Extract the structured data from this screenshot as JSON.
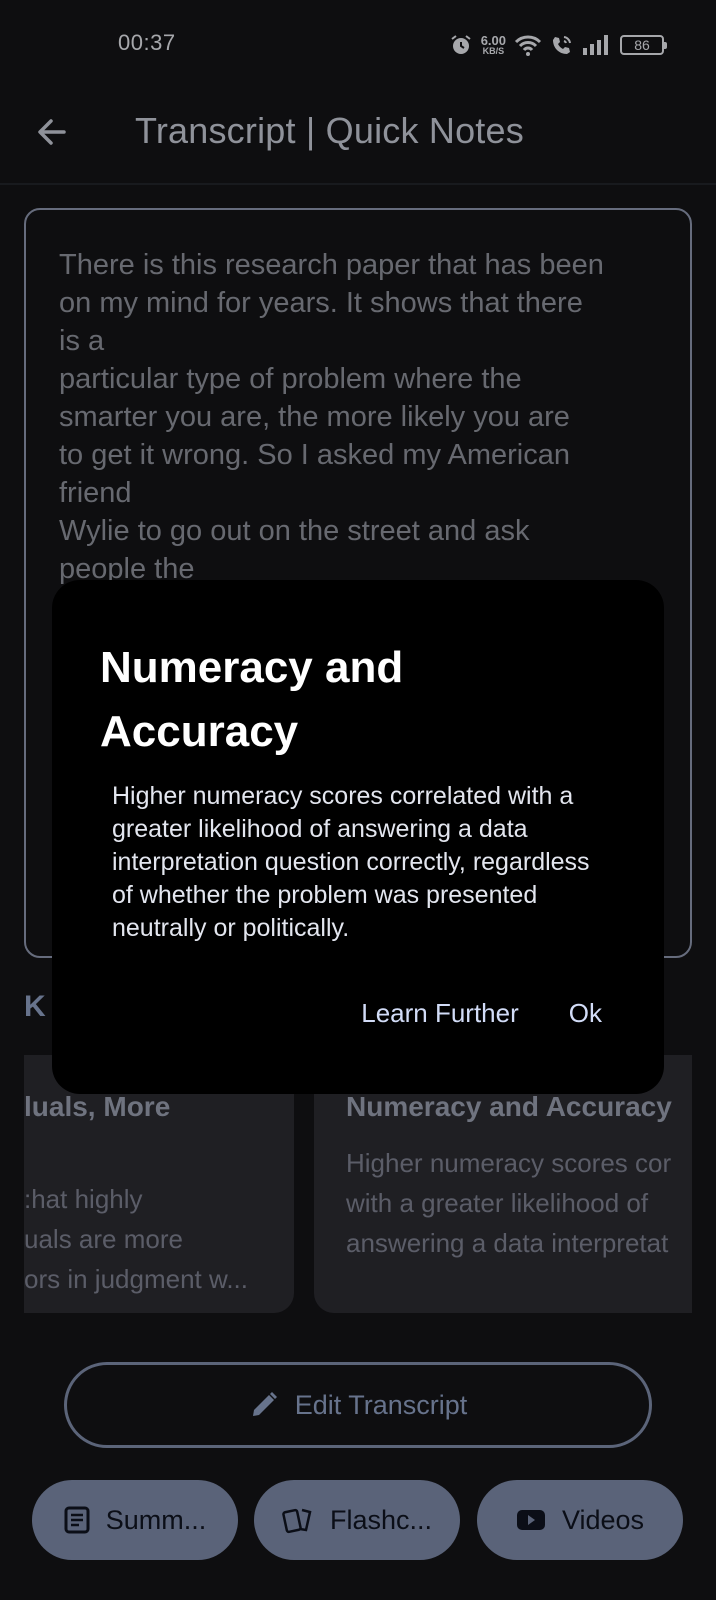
{
  "status_bar": {
    "time": "00:37",
    "net_speed": "6.00",
    "net_unit": "KB/S",
    "battery": "86"
  },
  "app_bar": {
    "title": "Transcript | Quick Notes"
  },
  "transcript": {
    "text": "There is this research paper that has been\non my mind for years. It shows that there\nis a\nparticular type of problem where the\nsmarter you are, the more likely you are\nto get it wrong. So I asked my American\nfriend\nWylie to go out on the street and ask\npeople the"
  },
  "key_section": {
    "header_visible": "K"
  },
  "cards": [
    {
      "title": "luals, More",
      "body": ":hat highly\nuals are more\nors in judgment w..."
    },
    {
      "title": "Numeracy and Accuracy",
      "body": "Higher numeracy scores cor\nwith a greater likelihood of\nanswering a data interpretat"
    }
  ],
  "edit_button": {
    "label": "Edit Transcript"
  },
  "bottom_tabs": [
    {
      "label": "Summ...",
      "icon": "document-icon"
    },
    {
      "label": "Flashc...",
      "icon": "cards-icon"
    },
    {
      "label": "Videos",
      "icon": "video-icon"
    }
  ],
  "dialog": {
    "title": "Numeracy and Accuracy",
    "body": "Higher numeracy scores correlated with a greater likelihood of answering a data interpretation question correctly, regardless of whether the problem was presented neutrally or politically.",
    "learn_label": "Learn Further",
    "ok_label": "Ok"
  }
}
